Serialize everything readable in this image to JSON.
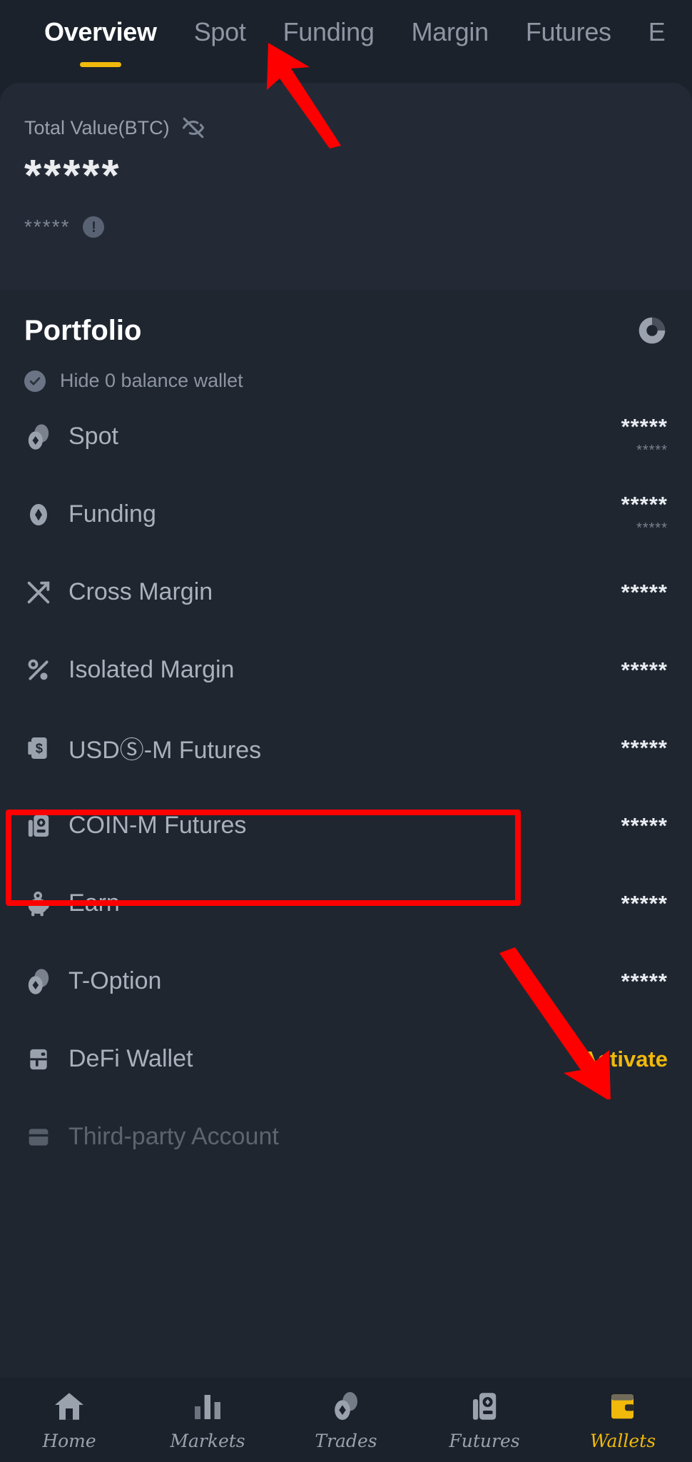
{
  "topbar": {
    "tabs": [
      {
        "label": "Overview",
        "active": true
      },
      {
        "label": "Spot",
        "active": false
      },
      {
        "label": "Funding",
        "active": false
      },
      {
        "label": "Margin",
        "active": false
      },
      {
        "label": "Futures",
        "active": false
      },
      {
        "label": "E",
        "active": false
      }
    ]
  },
  "total_value": {
    "label": "Total Value(BTC)",
    "eye_icon": "eye-off-icon",
    "masked_value": "*****",
    "masked_sub_value": "*****",
    "info_icon": "exclamation-circle-icon"
  },
  "portfolio": {
    "title": "Portfolio",
    "pie_icon": "pie-chart-icon",
    "hide_zero_label": "Hide 0 balance wallet",
    "hide_zero_checked": true,
    "rows": [
      {
        "icon": "spot-icon",
        "label": "Spot",
        "value": "*****",
        "sub_value": "*****",
        "action": ""
      },
      {
        "icon": "funding-icon",
        "label": "Funding",
        "value": "*****",
        "sub_value": "*****",
        "action": ""
      },
      {
        "icon": "cross-margin-icon",
        "label": "Cross Margin",
        "value": "*****",
        "sub_value": "",
        "action": ""
      },
      {
        "icon": "isolated-margin-icon",
        "label": "Isolated Margin",
        "value": "*****",
        "sub_value": "",
        "action": ""
      },
      {
        "icon": "usd-futures-icon",
        "label": "USDⓈ-M Futures",
        "value": "*****",
        "sub_value": "",
        "action": ""
      },
      {
        "icon": "coin-futures-icon",
        "label": "COIN-M Futures",
        "value": "*****",
        "sub_value": "",
        "action": ""
      },
      {
        "icon": "piggy-bank-icon",
        "label": "Earn",
        "value": "*****",
        "sub_value": "",
        "action": ""
      },
      {
        "icon": "t-option-icon",
        "label": "T-Option",
        "value": "*****",
        "sub_value": "",
        "action": ""
      },
      {
        "icon": "defi-wallet-icon",
        "label": "DeFi Wallet",
        "value": "",
        "sub_value": "",
        "action": "Activate"
      },
      {
        "icon": "third-party-icon",
        "label": "Third-party Account",
        "value": "",
        "sub_value": "",
        "action": ""
      }
    ]
  },
  "bottom_nav": {
    "items": [
      {
        "label": "Home",
        "icon": "home-icon",
        "active": false
      },
      {
        "label": "Markets",
        "icon": "markets-icon",
        "active": false
      },
      {
        "label": "Trades",
        "icon": "trades-icon",
        "active": false
      },
      {
        "label": "Futures",
        "icon": "futures-icon",
        "active": false
      },
      {
        "label": "Wallets",
        "icon": "wallet-icon",
        "active": true
      }
    ]
  },
  "annotations": {
    "highlight_color": "#ff0000",
    "arrow_to_funding_tab": "arrow-pointing-up-left",
    "arrow_to_wallets_nav": "arrow-pointing-down-right"
  },
  "colors": {
    "accent": "#f0b90b",
    "background": "#1b222c",
    "panel": "#232a35",
    "list_bg": "#1f2630",
    "text_primary": "#eaecef",
    "text_secondary": "#8f96a3"
  }
}
